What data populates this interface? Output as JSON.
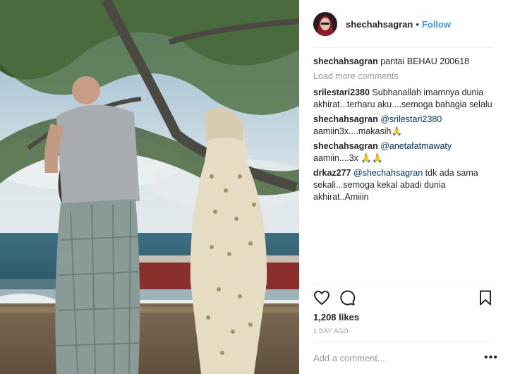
{
  "post": {
    "author": "shechahsagran",
    "follow_label": "Follow",
    "separator": "•",
    "caption": {
      "user": "shechahsagran",
      "text": "pantai BEHAU 200618"
    },
    "load_more_label": "Load more comments",
    "comments": [
      {
        "user": "srilestari2380",
        "mention": "",
        "text": "Subhanallah imamnya dunia akhirat...terharu aku....semoga bahagia selalu"
      },
      {
        "user": "shechahsagran",
        "mention": "@srilestari2380",
        "text": "aamiin3x....makasih🙏"
      },
      {
        "user": "shechahsagran",
        "mention": "@anetafatmawaty",
        "text": "aamiin....3x 🙏🙏"
      },
      {
        "user": "drkaz277",
        "mention": "@shechahsagran",
        "text": "tdk ada sama sekali...semoga kekal abadi dunia akhirat..Amiiin"
      }
    ],
    "likes_text": "1,208 likes",
    "time_text": "1 DAY AGO",
    "add_comment_placeholder": "Add a comment...",
    "more_label": "•••"
  },
  "icons": {
    "heart": "heart-icon",
    "comment": "comment-bubble-icon",
    "bookmark": "bookmark-icon",
    "avatar": "avatar"
  },
  "colors": {
    "follow": "#3897f0",
    "mention": "#003569",
    "muted": "#999999"
  }
}
